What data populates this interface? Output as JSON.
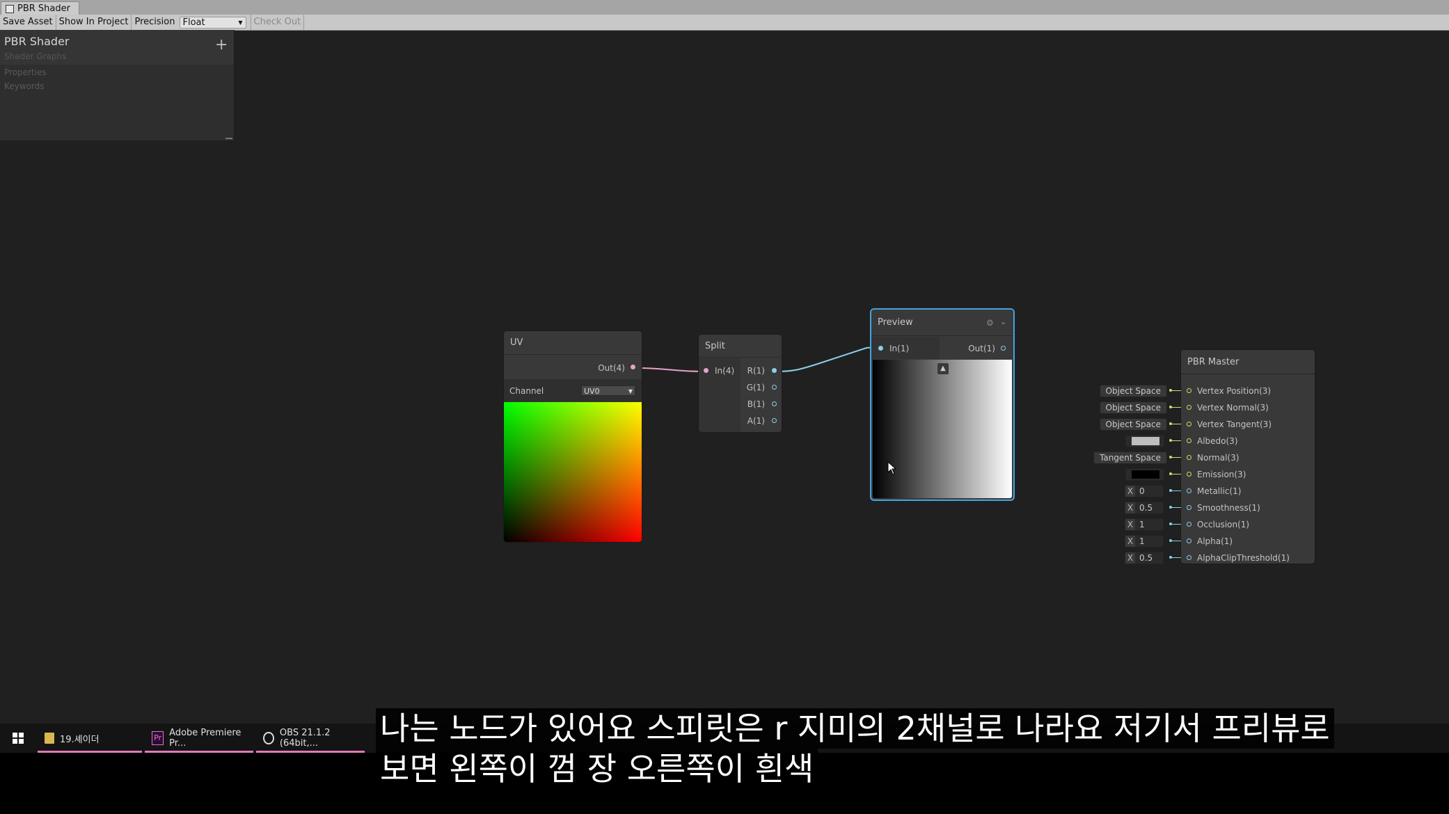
{
  "window": {
    "tab_title": "PBR Shader"
  },
  "toolbar": {
    "save_asset": "Save Asset",
    "show_in_project": "Show In Project",
    "precision_label": "Precision",
    "precision_value": "Float",
    "check_out": "Check Out"
  },
  "blackboard": {
    "title": "PBR Shader",
    "subtitle": "Shader Graphs",
    "add": "+",
    "properties": "Properties",
    "keywords": "Keywords"
  },
  "uv_node": {
    "title": "UV",
    "out_port": "Out(4)",
    "channel_label": "Channel",
    "channel_value": "UV0"
  },
  "split_node": {
    "title": "Split",
    "in_port": "In(4)",
    "out_ports": [
      "R(1)",
      "G(1)",
      "B(1)",
      "A(1)"
    ]
  },
  "preview_node": {
    "title": "Preview",
    "in_port": "In(1)",
    "out_port": "Out(1)"
  },
  "master_node": {
    "title": "PBR Master",
    "inputs": [
      {
        "label": "Vertex Position(3)",
        "field": "Object Space",
        "kind": "space"
      },
      {
        "label": "Vertex Normal(3)",
        "field": "Object Space",
        "kind": "space"
      },
      {
        "label": "Vertex Tangent(3)",
        "field": "Object Space",
        "kind": "space"
      },
      {
        "label": "Albedo(3)",
        "field": "",
        "kind": "color",
        "color": "#bdbdbd"
      },
      {
        "label": "Normal(3)",
        "field": "Tangent Space",
        "kind": "space"
      },
      {
        "label": "Emission(3)",
        "field": "",
        "kind": "color",
        "color": "#000000"
      },
      {
        "label": "Metallic(1)",
        "field": "0",
        "kind": "float",
        "axis": "X"
      },
      {
        "label": "Smoothness(1)",
        "field": "0.5",
        "kind": "float",
        "axis": "X"
      },
      {
        "label": "Occlusion(1)",
        "field": "1",
        "kind": "float",
        "axis": "X"
      },
      {
        "label": "Alpha(1)",
        "field": "1",
        "kind": "float",
        "axis": "X"
      },
      {
        "label": "AlphaClipThreshold(1)",
        "field": "0.5",
        "kind": "float",
        "axis": "X"
      }
    ]
  },
  "taskbar": {
    "items": [
      {
        "label": "19.셰이더",
        "icon": "folder-icon"
      },
      {
        "label": "Adobe Premiere Pr...",
        "icon": "premiere-icon",
        "badge": "Pr"
      },
      {
        "label": "OBS 21.1.2 (64bit,...",
        "icon": "obs-icon"
      }
    ]
  },
  "subtitle": {
    "line1": "나는 노드가 있어요 스피릿은 r 지미의 2채널로 나라요 저기서 프리뷰로",
    "line2": "보면 왼쪽이 껌 장 오른쪽이 흰색"
  },
  "colors": {
    "canvas": "#202020",
    "selection": "#44a4e0",
    "vector4_wire": "#e8a2c8",
    "float_wire": "#8ad0e6",
    "vector3_port": "#d8d86a"
  }
}
